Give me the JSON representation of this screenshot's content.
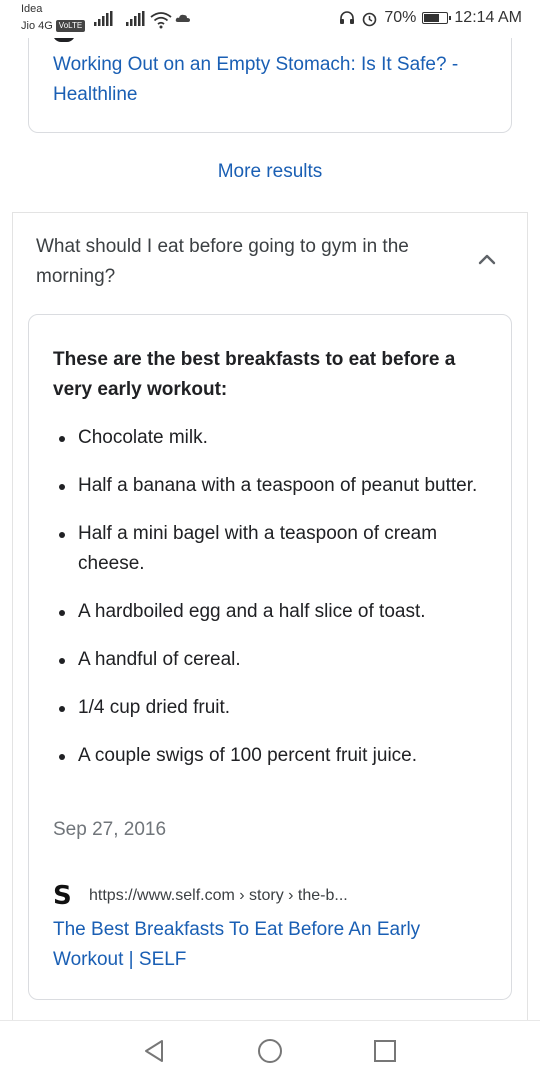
{
  "status_bar": {
    "carrier_primary": "Idea",
    "carrier_secondary": "Jio 4G",
    "volte_badge": "VoLTE",
    "battery_percent": "70%",
    "battery_level": 0.7,
    "time": "12:14 AM"
  },
  "previous_result": {
    "title": "Working Out on an Empty Stomach: Is It Safe? - Healthline"
  },
  "more_results_label": "More results",
  "faq": {
    "question": "What should I eat before going to gym in the morning?",
    "expanded": true,
    "answer_heading": "These are the best breakfasts to eat before a very early workout:",
    "answer_items": [
      "Chocolate milk.",
      "Half a banana with a teaspoon of peanut butter.",
      "Half a mini bagel with a teaspoon of cream cheese.",
      "A hardboiled egg and a half slice of toast.",
      "A handful of cereal.",
      "1/4 cup dried fruit.",
      "A couple swigs of 100 percent fruit juice."
    ],
    "date": "Sep 27, 2016",
    "source_logo": "S",
    "source_url": "https://www.self.com › story › the-b...",
    "source_title": "The Best Breakfasts To Eat Before An Early Workout | SELF"
  },
  "nav": {
    "back_icon": "triangle-back-icon",
    "home_icon": "circle-home-icon",
    "recents_icon": "square-recents-icon"
  },
  "colors": {
    "link": "#1a5fb4",
    "text": "#202124",
    "muted": "#70757a",
    "border": "#dadce0"
  }
}
